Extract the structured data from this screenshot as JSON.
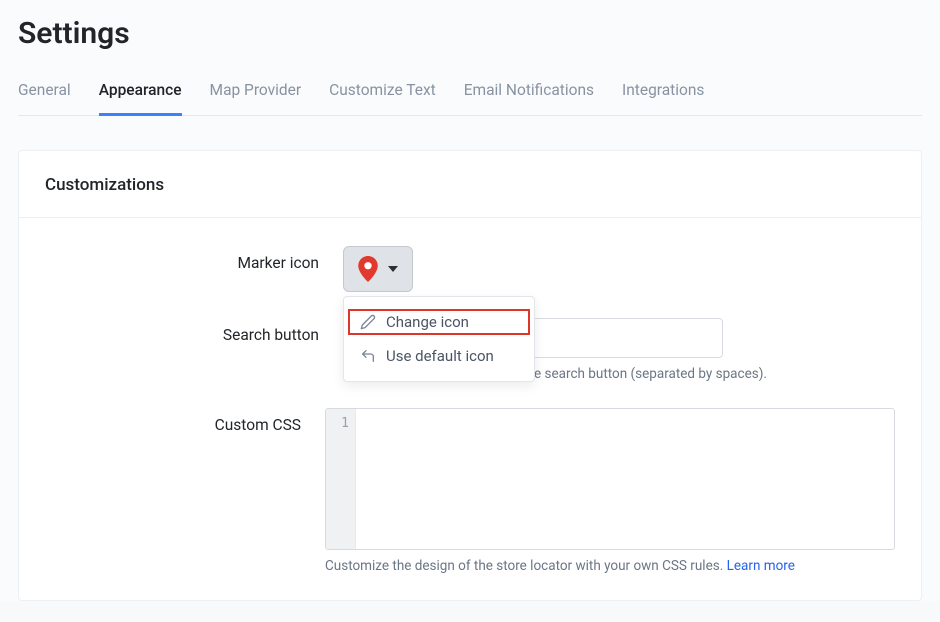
{
  "page": {
    "title": "Settings"
  },
  "tabs": [
    {
      "label": "General",
      "active": false
    },
    {
      "label": "Appearance",
      "active": true
    },
    {
      "label": "Map Provider",
      "active": false
    },
    {
      "label": "Customize Text",
      "active": false
    },
    {
      "label": "Email Notifications",
      "active": false
    },
    {
      "label": "Integrations",
      "active": false
    }
  ],
  "panel": {
    "title": "Customizations"
  },
  "form": {
    "marker_icon": {
      "label": "Marker icon",
      "menu": {
        "change": "Change icon",
        "default": "Use default icon"
      }
    },
    "search_button": {
      "label": "Search button",
      "value": "",
      "help": "Insert custom CSS classes to the search button (separated by spaces)."
    },
    "custom_css": {
      "label": "Custom CSS",
      "value": "",
      "line_number": "1",
      "help": "Customize the design of the store locator with your own CSS rules. ",
      "help_link": "Learn more"
    }
  },
  "colors": {
    "marker": "#e2392f",
    "accent": "#3b82f6",
    "highlight": "#e0352b"
  }
}
